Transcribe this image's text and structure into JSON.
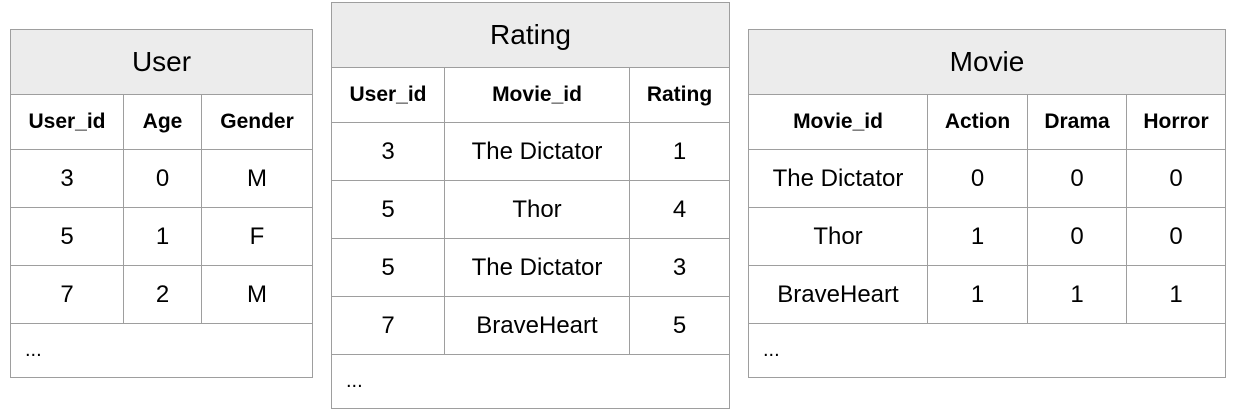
{
  "user": {
    "title": "User",
    "headers": [
      "User_id",
      "Age",
      "Gender"
    ],
    "rows": [
      [
        "3",
        "0",
        "M"
      ],
      [
        "5",
        "1",
        "F"
      ],
      [
        "7",
        "2",
        "M"
      ]
    ],
    "ellipsis": "..."
  },
  "rating": {
    "title": "Rating",
    "headers": [
      "User_id",
      "Movie_id",
      "Rating"
    ],
    "rows": [
      [
        "3",
        "The Dictator",
        "1"
      ],
      [
        "5",
        "Thor",
        "4"
      ],
      [
        "5",
        "The Dictator",
        "3"
      ],
      [
        "7",
        "BraveHeart",
        "5"
      ]
    ],
    "ellipsis": "..."
  },
  "movie": {
    "title": "Movie",
    "headers": [
      "Movie_id",
      "Action",
      "Drama",
      "Horror"
    ],
    "rows": [
      [
        "The Dictator",
        "0",
        "0",
        "0"
      ],
      [
        "Thor",
        "1",
        "0",
        "0"
      ],
      [
        "BraveHeart",
        "1",
        "1",
        "1"
      ]
    ],
    "ellipsis": "..."
  },
  "colors": {
    "border": "#9e9e9e",
    "title_background": "#ececec"
  }
}
